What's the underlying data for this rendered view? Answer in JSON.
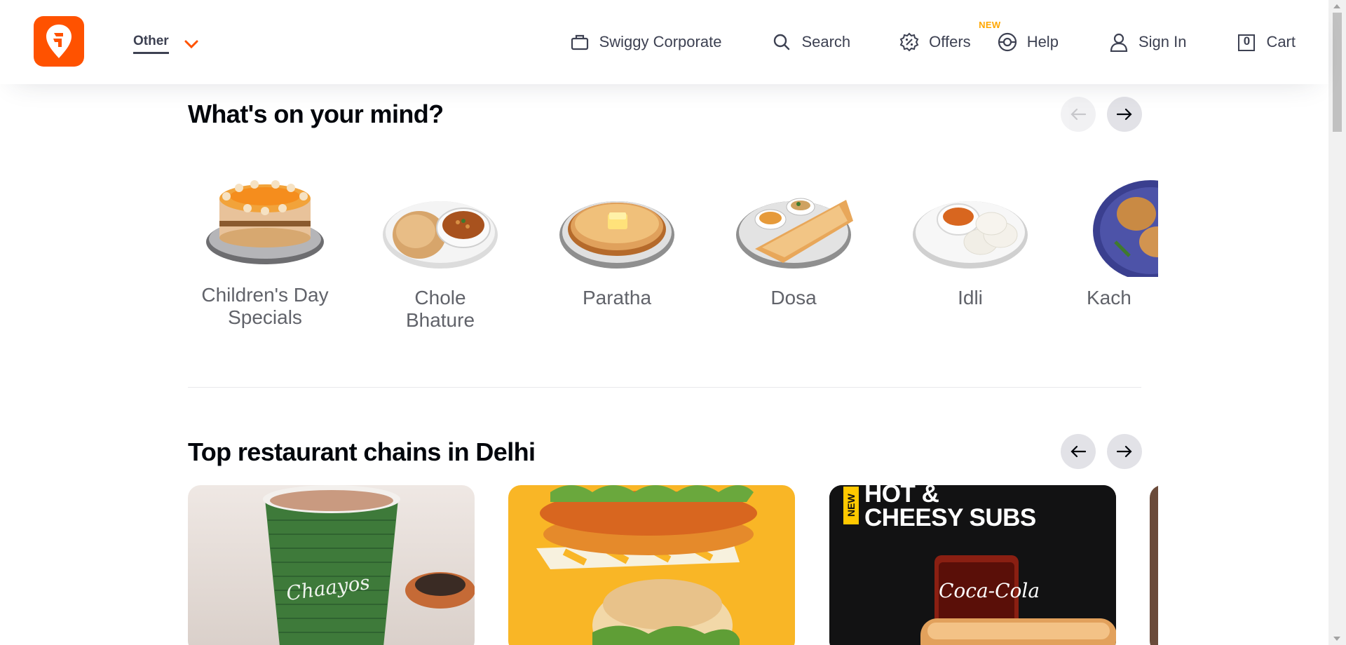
{
  "header": {
    "location_label": "Other",
    "nav": {
      "corporate": "Swiggy Corporate",
      "search": "Search",
      "offers": "Offers",
      "offers_badge": "NEW",
      "help": "Help",
      "signin": "Sign In",
      "cart": "Cart",
      "cart_count": "0"
    }
  },
  "mind_section": {
    "title": "What's on your mind?",
    "items": [
      {
        "label": "Children's Day Specials",
        "icon": "cake-image"
      },
      {
        "label": "Chole Bhature",
        "icon": "chole-bhature-image"
      },
      {
        "label": "Paratha",
        "icon": "paratha-image"
      },
      {
        "label": "Dosa",
        "icon": "dosa-image"
      },
      {
        "label": "Idli",
        "icon": "idli-image"
      },
      {
        "label": "Kach",
        "icon": "kachori-image"
      }
    ]
  },
  "chains_section": {
    "title": "Top restaurant chains in Delhi",
    "cards": [
      {
        "brand_text": "Chaayos"
      },
      {
        "brand_text": ""
      },
      {
        "badge": "NEW",
        "headline": "HOT & CHEESY SUBS",
        "brand_text": "Coca-Cola"
      }
    ]
  },
  "colors": {
    "brand": "#ff5200",
    "text_dark": "#02060c",
    "text_nav": "#3d4152",
    "label_gray": "#61636a",
    "badge_new": "#ffa700"
  }
}
